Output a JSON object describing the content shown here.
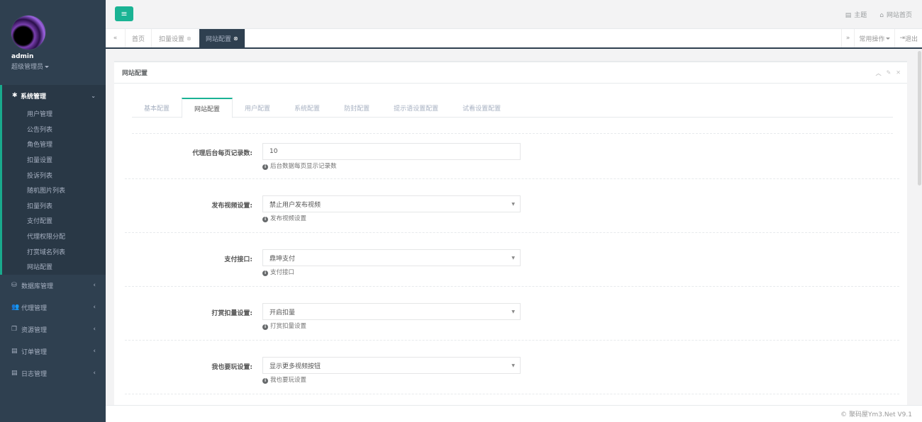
{
  "profile": {
    "name": "admin",
    "role": "超级管理员"
  },
  "sidebar": {
    "active_group": {
      "icon": "gear-icon",
      "label": "系统管理",
      "items": [
        "用户管理",
        "公告列表",
        "角色管理",
        "扣量设置",
        "投诉列表",
        "随机图片列表",
        "扣量列表",
        "支付配置",
        "代理权限分配",
        "打赏域名列表",
        "网站配置"
      ]
    },
    "groups": [
      {
        "icon": "database-icon",
        "label": "数据库管理"
      },
      {
        "icon": "users-icon",
        "label": "代理管理"
      },
      {
        "icon": "copy-icon",
        "label": "资源管理"
      },
      {
        "icon": "list-icon",
        "label": "订单管理"
      },
      {
        "icon": "list-icon",
        "label": "日志管理"
      }
    ]
  },
  "topbar": {
    "theme_label": "主题",
    "home_label": "网站首页"
  },
  "page_tabs": [
    {
      "label": "首页",
      "closable": false
    },
    {
      "label": "扣量设置",
      "closable": true
    },
    {
      "label": "网站配置",
      "closable": true,
      "active": true
    }
  ],
  "tab_tools": {
    "common_ops": "常用操作",
    "logout": "退出"
  },
  "panel": {
    "title": "网站配置"
  },
  "config_tabs": [
    "基本配置",
    "网站配置",
    "用户配置",
    "系统配置",
    "防封配置",
    "提示语设置配置",
    "试看设置配置"
  ],
  "active_config_tab": "网站配置",
  "form": [
    {
      "label": "代理后台每页记录数:",
      "type": "input",
      "value": "10",
      "help": "后台数据每页显示记录数"
    },
    {
      "label": "发布视频设置:",
      "type": "select",
      "value": "禁止用户发布视频",
      "help": "发布视频设置"
    },
    {
      "label": "支付接口:",
      "type": "select",
      "value": "鼎坤支付",
      "help": "支付接口"
    },
    {
      "label": "打赏扣量设置:",
      "type": "select",
      "value": "开启扣量",
      "help": "打赏扣量设置"
    },
    {
      "label": "我也要玩设置:",
      "type": "select",
      "value": "显示更多视频按钮",
      "help": "我也要玩设置"
    }
  ],
  "footer": {
    "text": "© 聚码屋Ym3.Net V9.1"
  },
  "colors": {
    "sidebar_bg": "#2f4050",
    "accent": "#1ab394"
  }
}
